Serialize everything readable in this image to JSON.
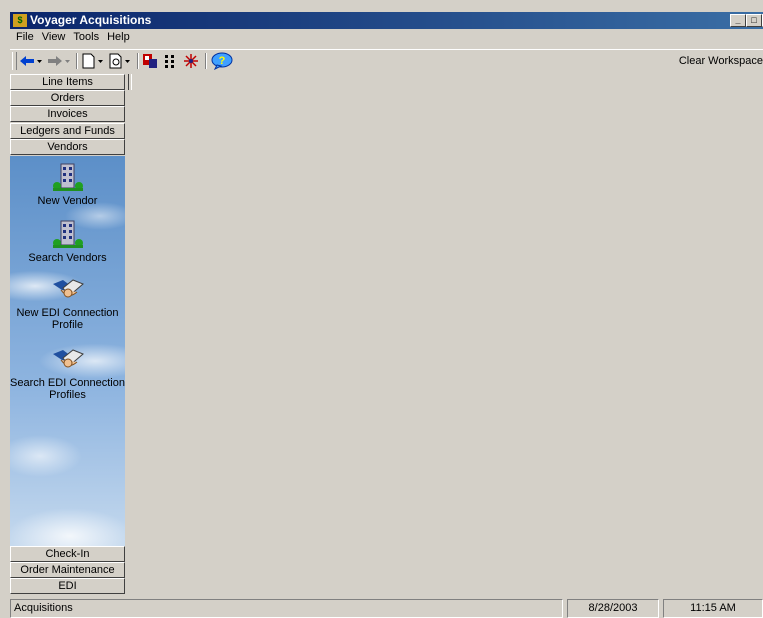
{
  "window": {
    "title": "Voyager Acquisitions",
    "app_icon": "voyager-app-icon",
    "min_glyph": "_",
    "max_glyph": "□",
    "close_glyph": "×"
  },
  "menu": [
    "File",
    "View",
    "Tools",
    "Help"
  ],
  "toolbar": {
    "icons": [
      "back-arrow-icon",
      "forward-arrow-icon",
      "new-document-icon",
      "print-preview-icon",
      "record-icon",
      "columns-icon",
      "asterisk-icon",
      "help-icon"
    ],
    "clear_workspace": "Clear Workspace"
  },
  "sidebar": {
    "top_modules": [
      "Line Items",
      "Orders",
      "Invoices",
      "Ledgers and Funds",
      "Vendors"
    ],
    "shortcuts": [
      "New Vendor",
      "Search Vendors",
      "New EDI Connection Profile",
      "Search EDI Connection Profiles"
    ],
    "bottom_modules": [
      "Check-In",
      "Order Maintenance",
      "EDI"
    ]
  },
  "status": {
    "module": "Acquisitions",
    "date": "8/28/2003",
    "time": "11:15 AM"
  },
  "colors": {
    "title_bar": "#0a246a",
    "face": "#d4d0c8",
    "panel_sky": "#6f9ed4"
  }
}
